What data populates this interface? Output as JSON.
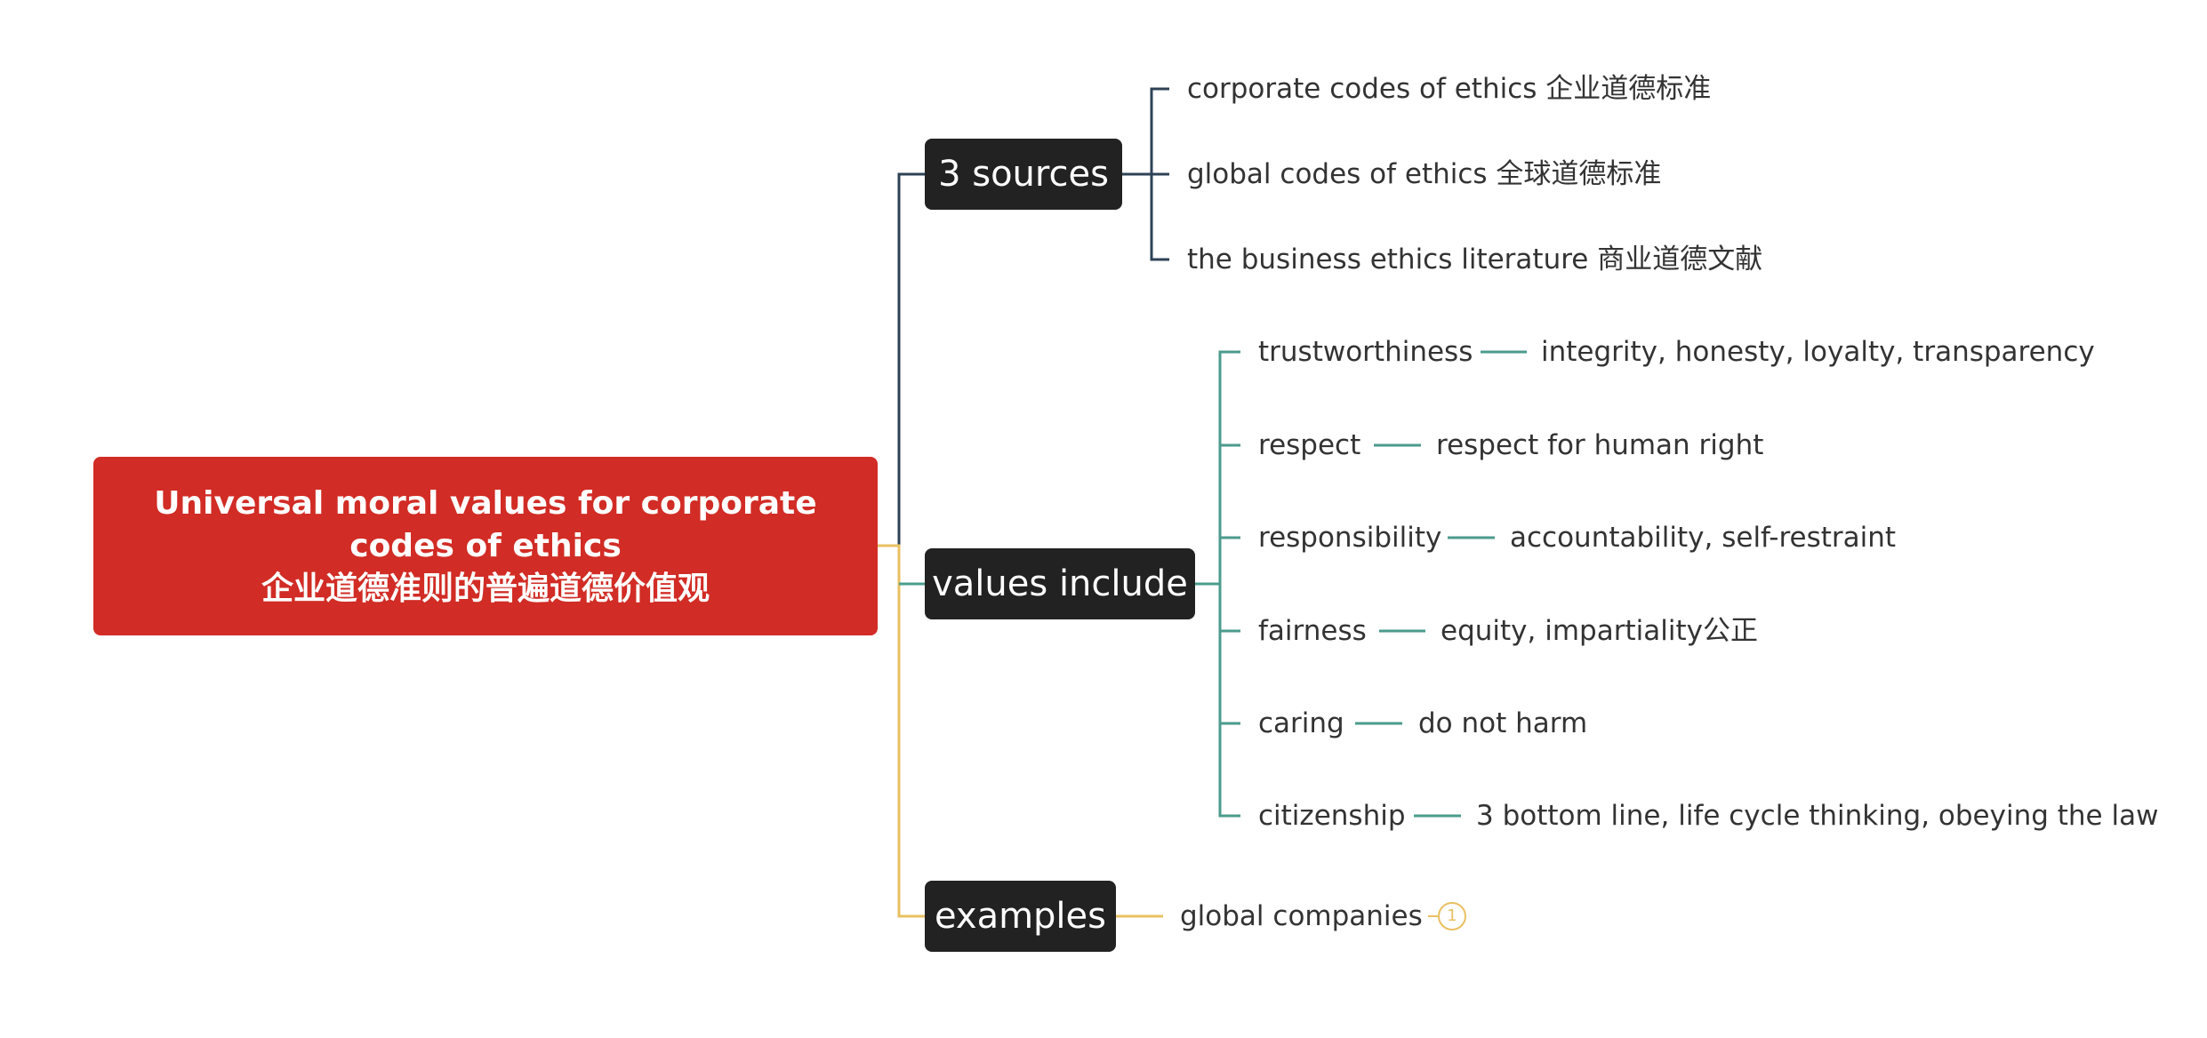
{
  "colors": {
    "root": "#d12c25",
    "branch_box": "#222222",
    "line_sources": "#2e4256",
    "line_values": "#4b9b8e",
    "line_examples": "#e8c062",
    "text": "#333333"
  },
  "root": {
    "line1": "Universal moral values for corporate",
    "line2": "codes of ethics",
    "line3": "企业道德准则的普遍道德价值观"
  },
  "sources": {
    "label": "3 sources",
    "items": [
      "corporate codes of ethics 企业道德标准",
      "global codes of ethics 全球道德标准",
      "the business ethics literature 商业道德文献"
    ]
  },
  "values": {
    "label": "values include",
    "items": [
      {
        "name": "trustworthiness",
        "detail": "integrity, honesty, loyalty, transparency"
      },
      {
        "name": "respect",
        "detail": "respect for human right"
      },
      {
        "name": "responsibility",
        "detail": "accountability, self-restraint"
      },
      {
        "name": "fairness",
        "detail": "equity, impartiality公正"
      },
      {
        "name": "caring",
        "detail": "do not harm"
      },
      {
        "name": "citizenship",
        "detail": "3 bottom line, life cycle thinking, obeying the law"
      }
    ]
  },
  "examples": {
    "label": "examples",
    "items": [
      "global companies"
    ],
    "badge": "1"
  }
}
